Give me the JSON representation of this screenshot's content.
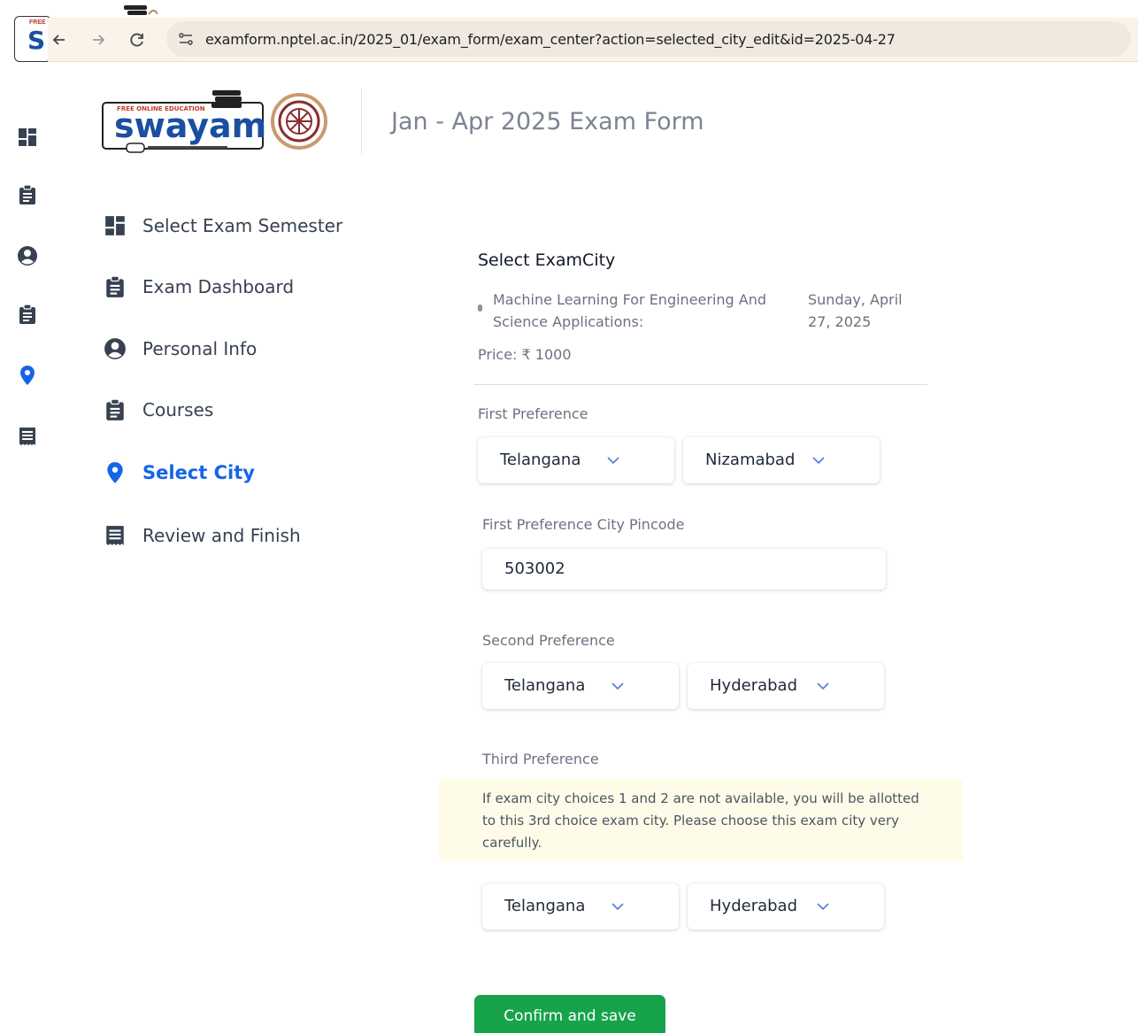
{
  "browser": {
    "url": "examform.nptel.ac.in/2025_01/exam_form/exam_center?action=selected_city_edit&id=2025-04-27"
  },
  "favicon": {
    "letter": "S",
    "tag": "FREE"
  },
  "header": {
    "logo_text": "swayam",
    "logo_tagline": "FREE ONLINE EDUCATION",
    "title": "Jan - Apr 2025 Exam Form"
  },
  "steps": [
    {
      "label": "Select Exam Semester",
      "icon": "dashboard-icon",
      "active": false
    },
    {
      "label": "Exam Dashboard",
      "icon": "clipboard-icon",
      "active": false
    },
    {
      "label": "Personal Info",
      "icon": "user-circle-icon",
      "active": false
    },
    {
      "label": "Courses",
      "icon": "clipboard-icon",
      "active": false
    },
    {
      "label": "Select City",
      "icon": "map-pin-icon",
      "active": true
    },
    {
      "label": "Review and Finish",
      "icon": "receipt-icon",
      "active": false
    }
  ],
  "form": {
    "section_title": "Select ExamCity",
    "course_name": "Machine Learning For Engineering And Science Applications:",
    "course_date": "Sunday, April 27, 2025",
    "price": "Price: ₹ 1000",
    "first_pref": {
      "label": "First Preference",
      "state": "Telangana",
      "city": "Nizamabad"
    },
    "pincode": {
      "label": "First Preference City Pincode",
      "value": "503002"
    },
    "second_pref": {
      "label": "Second Preference",
      "state": "Telangana",
      "city": "Hyderabad"
    },
    "third_pref": {
      "label": "Third Preference",
      "warning": "If exam city choices 1 and 2 are not available, you will be allotted to this 3rd choice exam city. Please choose this exam city very carefully.",
      "state": "Telangana",
      "city": "Hyderabad"
    },
    "confirm_label": "Confirm and save"
  },
  "colors": {
    "accent": "#1565e8",
    "confirm": "#16a34a",
    "warning_bg": "#fefce8",
    "icon_dark": "#374151"
  }
}
